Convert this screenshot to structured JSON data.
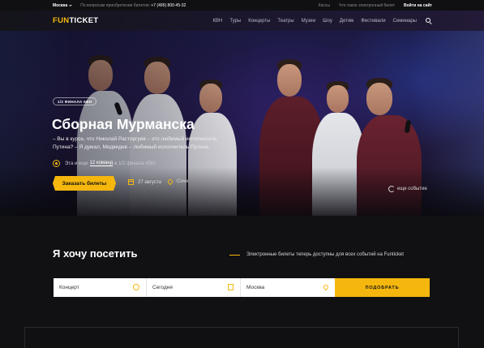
{
  "topbar": {
    "city": "Москва",
    "phone_label": "По вопросам приобретения билетов:",
    "phone": "+7 (495) 800-45-32",
    "links": [
      "Кассы",
      "Что такое электронный билет"
    ],
    "login": "Войти на сайт"
  },
  "nav": {
    "logo_fun": "FUN",
    "logo_ticket": "TICKET",
    "items": [
      "КВН",
      "Туры",
      "Концерты",
      "Театры",
      "Музеи",
      "Шоу",
      "Детям",
      "Фестивали",
      "Семинары"
    ],
    "search_icon": "search-icon"
  },
  "hero": {
    "badge": "1/2 ФИНАЛА КВН",
    "title": "Сборная Мурманска",
    "quote_line1": "– Вы в курсе, что Николай Расторгуев – это любимый исполнитель",
    "quote_line2": "Путина? – Я думал, Медведев – любимый исполнитель Путина.",
    "note_before": "Эта и еще",
    "note_link": "12 команд",
    "note_after": "в 1/2 финала КВН",
    "buy_button": "Заказать билеты",
    "date": "27 августа",
    "place": "Сочи",
    "more_link": "еще событие",
    "accent": "#f5b70e"
  },
  "visit": {
    "title": "Я хочу посетить",
    "note": "Электронные билеты теперь доступны для всех событий на Funticket",
    "fields": {
      "category": "Концерт",
      "date": "Сегодня",
      "city": "Москва"
    },
    "submit": "ПОДОБРАТЬ"
  }
}
